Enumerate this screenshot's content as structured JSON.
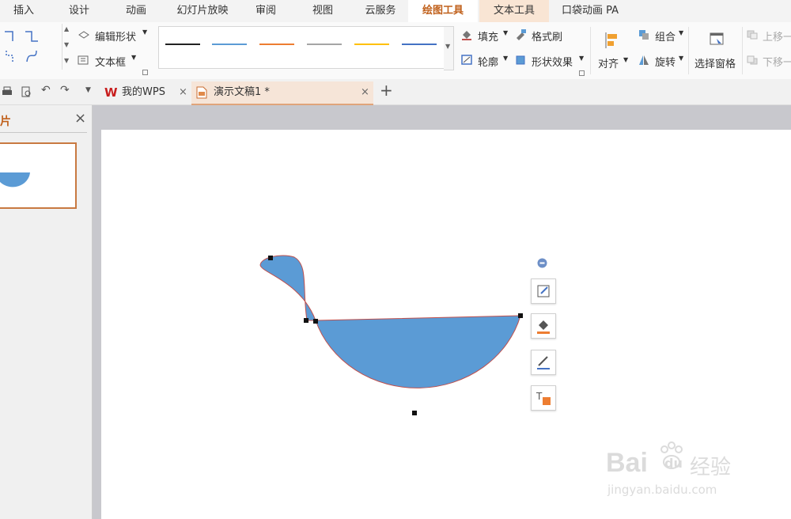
{
  "menu": {
    "items": [
      "插入",
      "设计",
      "动画",
      "幻灯片放映",
      "审阅",
      "视图",
      "云服务",
      "绘图工具",
      "文本工具",
      "口袋动画 PA"
    ],
    "active": "绘图工具"
  },
  "ribbon": {
    "edit_shape": "编辑形状",
    "text_box": "文本框",
    "fill": "填充",
    "format_painter": "格式刷",
    "outline": "轮廓",
    "shape_effect": "形状效果",
    "align": "对齐",
    "group": "组合",
    "rotate": "旋转",
    "selection_pane": "选择窗格",
    "bring_forward": "上移一",
    "send_backward": "下移一",
    "line_colors": [
      "#222222",
      "#5b9bd5",
      "#ed7d31",
      "#a5a5a5",
      "#ffc000",
      "#4472c4"
    ]
  },
  "tabs": {
    "home": "我的WPS",
    "doc": "演示文稿1 *",
    "add": "+"
  },
  "panel": {
    "title": "片",
    "close": "×"
  },
  "shape": {
    "fill_color": "#5b9bd5",
    "outline_color": "#c0504d"
  },
  "watermark": {
    "brand": "Bai",
    "paw": "du",
    "cn": "经验",
    "url": "jingyan.baidu.com"
  }
}
